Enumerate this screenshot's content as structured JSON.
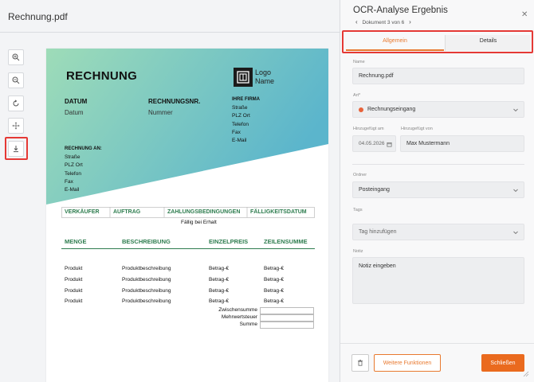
{
  "viewer": {
    "file_title": "Rechnung.pdf",
    "tools": [
      {
        "icon": "zoom-in-icon"
      },
      {
        "icon": "zoom-out-icon"
      },
      {
        "icon": "rotate-icon"
      },
      {
        "icon": "move-icon"
      },
      {
        "icon": "download-icon"
      }
    ]
  },
  "invoice": {
    "title": "RECHNUNG",
    "logo_line1": "Logo",
    "logo_line2": "Name",
    "datum_label": "DATUM",
    "datum_value": "Datum",
    "nr_label": "RECHNUNGSNR.",
    "nr_value": "Nummer",
    "firma_label": "IHRE FIRMA",
    "firma_lines": [
      "Straße",
      "PLZ Ort",
      "Telefon",
      "Fax",
      "E-Mail"
    ],
    "recipient_label": "RECHNUNG AN:",
    "recipient_lines": [
      "Straße",
      "PLZ Ort",
      "Telefon",
      "Fax",
      "E-Mail"
    ],
    "top_table_headers": [
      "VERKÄUFER",
      "AUFTRAG",
      "ZAHLUNGSBEDINGUNGEN",
      "FÄLLIGKEITSDATUM"
    ],
    "top_table_value": "Fällig bei Erhalt",
    "columns": [
      "MENGE",
      "BESCHREIBUNG",
      "EINZELPREIS",
      "ZEILENSUMME"
    ],
    "rows": [
      [
        "Produkt",
        "Produktbeschreibung",
        "Betrag-€",
        "Betrag-€"
      ],
      [
        "Produkt",
        "Produktbeschreibung",
        "Betrag-€",
        "Betrag-€"
      ],
      [
        "Produkt",
        "Produktbeschreibung",
        "Betrag-€",
        "Betrag-€"
      ],
      [
        "Produkt",
        "Produktbeschreibung",
        "Betrag-€",
        "Betrag-€"
      ]
    ],
    "summary_labels": [
      "Zwischensumme",
      "Mehrwertsteuer",
      "Summe"
    ],
    "gradient_colors": [
      "#9edcb8",
      "#5bb5cc"
    ],
    "heading_green": "#2e7d4f"
  },
  "panel": {
    "title": "OCR-Analyse Ergebnis",
    "doc_nav": "Dokument 3 von 6",
    "tabs": {
      "allgemein": "Allgemein",
      "details": "Details"
    },
    "name_label": "Name",
    "name_value": "Rechnung.pdf",
    "art_label": "Art*",
    "art_value": "Rechnungseingang",
    "art_dot_color": "#e8623a",
    "added_on_label": "Hinzugefügt am",
    "added_on_value": "04.05.2026",
    "added_by_label": "Hinzugefügt von",
    "added_by_value": "Max Mustermann",
    "folder_label": "Ordner",
    "folder_value": "Posteingang",
    "tags_label": "Tags",
    "tags_placeholder": "Tag hinzufügen",
    "note_label": "Notiz",
    "note_placeholder": "Notiz eingeben",
    "more_button": "Weitere Funktionen",
    "close_button": "Schließen",
    "accent_color": "#ea6a1e"
  }
}
